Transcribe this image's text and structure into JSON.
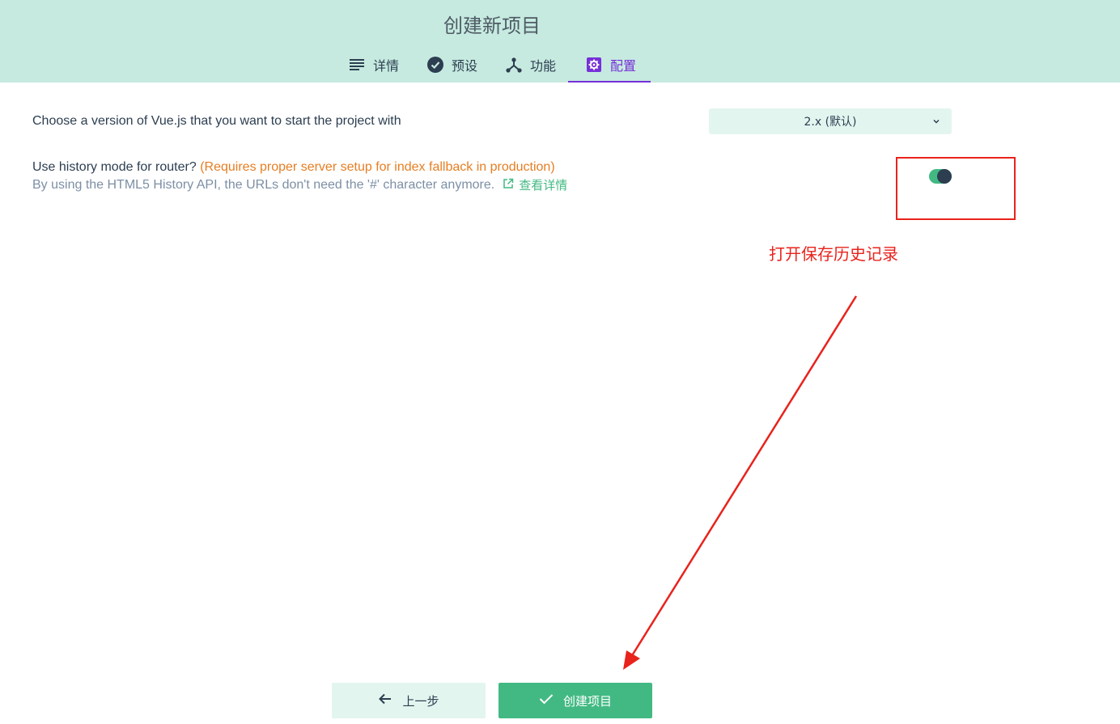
{
  "header": {
    "title": "创建新项目",
    "tabs": [
      {
        "label": "详情",
        "icon": "list-icon"
      },
      {
        "label": "预设",
        "icon": "check-circle-icon"
      },
      {
        "label": "功能",
        "icon": "fork-icon"
      },
      {
        "label": "配置",
        "icon": "settings-icon",
        "active": true
      }
    ]
  },
  "config": {
    "vue_version_label": "Choose a version of Vue.js that you want to start the project with",
    "vue_version_value": "2.x (默认)",
    "history_label": "Use history mode for router?",
    "history_warning": "(Requires proper server setup for index fallback in production)",
    "history_description": "By using the HTML5 History API, the URLs don't need the '#' character anymore.",
    "more_info_link": "查看详情",
    "history_enabled": true
  },
  "annotation": {
    "text": "打开保存历史记录",
    "color": "#e8231c"
  },
  "footer": {
    "prev_label": "上一步",
    "create_label": "创建项目"
  },
  "colors": {
    "header_bg": "#c6eadf",
    "accent_green": "#42b983",
    "active_tab": "#7630d8",
    "warning": "#e67e22"
  }
}
